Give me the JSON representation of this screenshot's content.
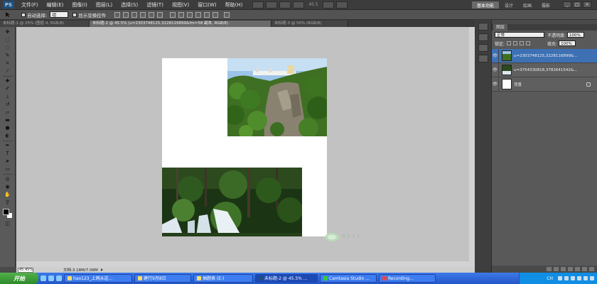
{
  "menubar": {
    "logo": "PS",
    "items": [
      "文件(F)",
      "编辑(E)",
      "图像(I)",
      "图层(L)",
      "选择(S)",
      "滤镜(T)",
      "视图(V)",
      "窗口(W)",
      "帮助(H)"
    ],
    "zoom": "45.5",
    "workspace": "基本功能",
    "workspace_links": [
      "设计",
      "绘画",
      "摄影"
    ],
    "window_controls": [
      "_",
      "□",
      "×"
    ]
  },
  "options_bar": {
    "auto_select_label": "自动选择:",
    "auto_select_value": "组",
    "show_transform_label": "显示变换控件"
  },
  "doc_tabs": [
    "未标题-1 @ 25% (图层 4, RGB/8)",
    "未标题-2 @ 45.5% (u=2303748125,3228116899&fm=58 副本, RGB/8)",
    "未标题-3 @ 50% (RGB/8)"
  ],
  "status": {
    "zoom": "45.45%",
    "doc_info": "文档:3.18M/7.06M"
  },
  "layers": {
    "tab_label": "图层",
    "blend_mode": "正常",
    "opacity_label": "不透明度:",
    "opacity_value": "100%",
    "lock_label": "锁定:",
    "fill_label": "填充:",
    "fill_value": "100%",
    "items": [
      {
        "name": "u=2303748125,3228116899&..."
      },
      {
        "name": "u=3754330818,3782641542&..."
      },
      {
        "name": "背景"
      }
    ]
  },
  "watermark": "X  1  1  1",
  "taskbar": {
    "start": "开始",
    "buttons": [
      "hao123_上网从这...",
      "建行9月8日",
      "抽题表 (E:)",
      "未标题-2 @ 45.5% ...",
      "Camtasia Studio ...",
      "Recording..."
    ],
    "tray_lang": "CH"
  },
  "colors": {
    "selection": "#3d71b4",
    "canvas_bg": "#c2c2c2",
    "taskbar": "#2455c8"
  }
}
